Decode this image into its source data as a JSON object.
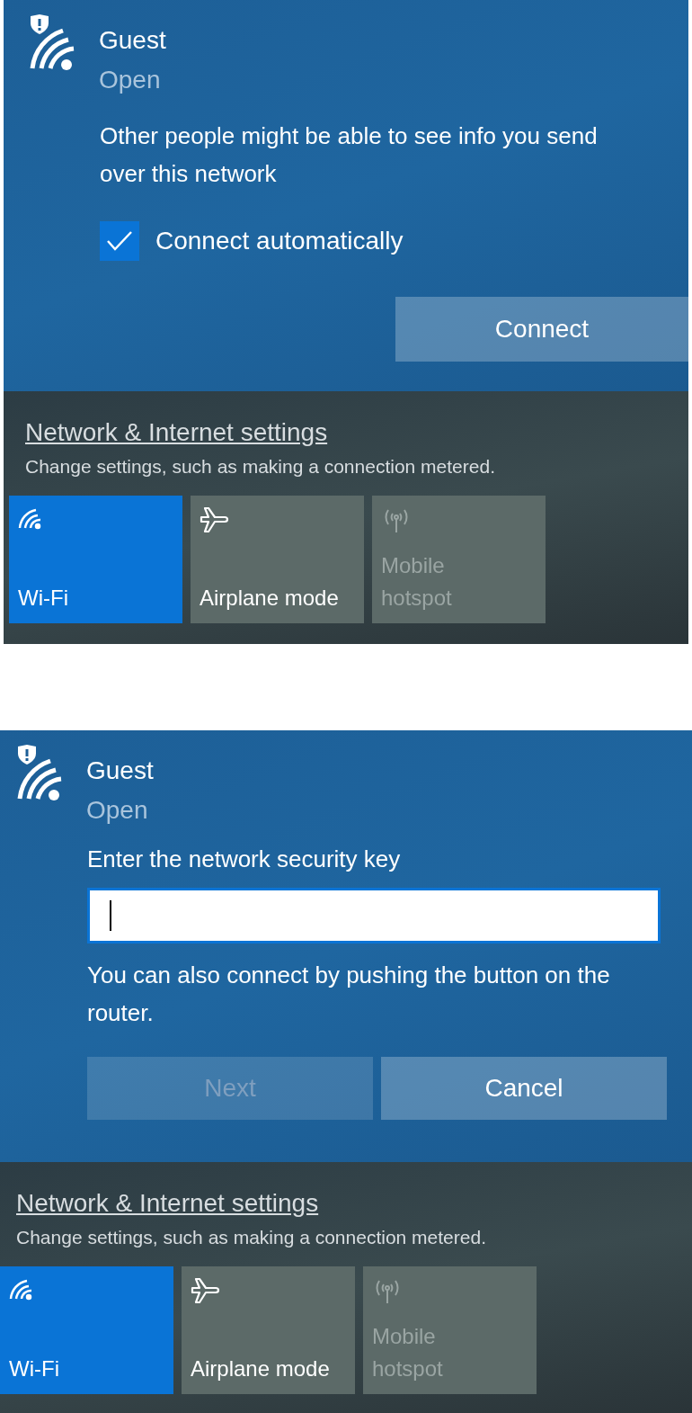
{
  "panels": [
    {
      "network": {
        "name": "Guest",
        "status": "Open"
      },
      "body": [
        {
          "kind": "text",
          "text": "Other people might be able to see info you send over this network"
        },
        {
          "kind": "checkbox",
          "label": "Connect automatically",
          "checked": true
        },
        {
          "kind": "buttons",
          "buttons": [
            {
              "label": "Connect",
              "disabled": false
            }
          ]
        }
      ],
      "settings": {
        "link": "Network & Internet settings",
        "description": "Change settings, such as making a connection metered."
      },
      "tiles": [
        {
          "kind": "wifi",
          "label": "Wi-Fi",
          "selected": true,
          "disabled": false
        },
        {
          "kind": "airplane",
          "label": "Airplane mode",
          "selected": false,
          "disabled": false
        },
        {
          "kind": "hotspot",
          "label": "Mobile hotspot",
          "selected": false,
          "disabled": true
        }
      ]
    },
    {
      "network": {
        "name": "Guest",
        "status": "Open"
      },
      "body": [
        {
          "kind": "field",
          "label": "Enter the network security key"
        },
        {
          "kind": "text",
          "text": "You can also connect by pushing the button on the router."
        },
        {
          "kind": "buttons",
          "buttons": [
            {
              "label": "Next",
              "disabled": true
            },
            {
              "label": "Cancel",
              "disabled": false
            }
          ]
        }
      ],
      "settings": {
        "link": "Network & Internet settings",
        "description": "Change settings, such as making a connection metered."
      },
      "tiles": [
        {
          "kind": "wifi",
          "label": "Wi-Fi",
          "selected": true,
          "disabled": false
        },
        {
          "kind": "airplane",
          "label": "Airplane mode",
          "selected": false,
          "disabled": false
        },
        {
          "kind": "hotspot",
          "label": "Mobile hotspot",
          "selected": false,
          "disabled": true
        }
      ]
    }
  ]
}
